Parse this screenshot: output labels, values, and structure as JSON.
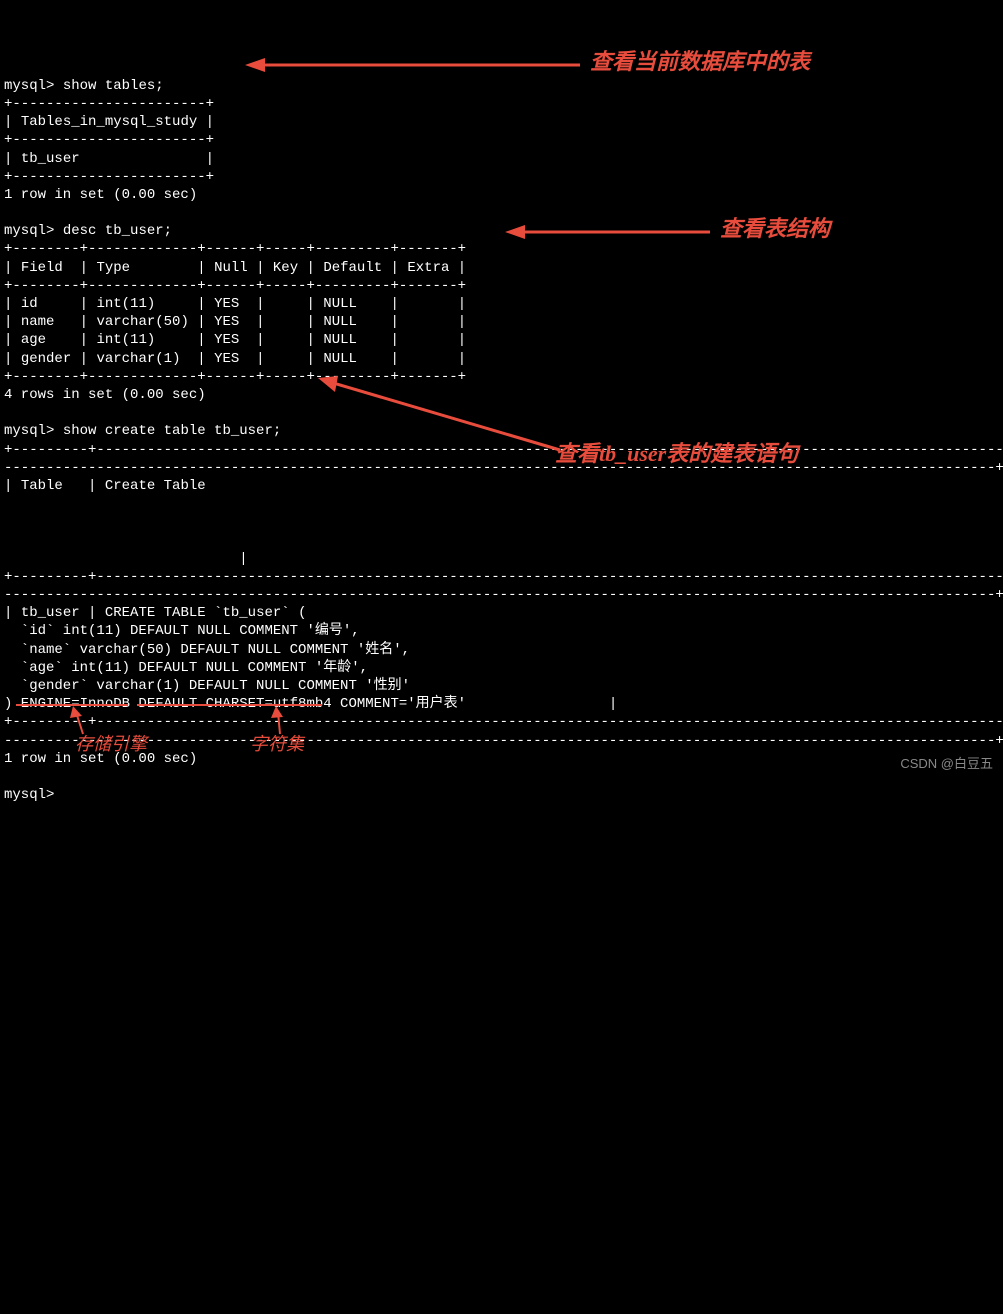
{
  "prompt": "mysql>",
  "cmd1": "show tables;",
  "tables_header": "Tables_in_mysql_study",
  "tables_row1": "tb_user",
  "tables_result": "1 row in set (0.00 sec)",
  "cmd2": "desc tb_user;",
  "desc": {
    "headers": [
      "Field",
      "Type",
      "Null",
      "Key",
      "Default",
      "Extra"
    ],
    "rows": [
      {
        "field": "id",
        "type": "int(11)",
        "null": "YES",
        "key": "",
        "default": "NULL",
        "extra": ""
      },
      {
        "field": "name",
        "type": "varchar(50)",
        "null": "YES",
        "key": "",
        "default": "NULL",
        "extra": ""
      },
      {
        "field": "age",
        "type": "int(11)",
        "null": "YES",
        "key": "",
        "default": "NULL",
        "extra": ""
      },
      {
        "field": "gender",
        "type": "varchar(1)",
        "null": "YES",
        "key": "",
        "default": "NULL",
        "extra": ""
      }
    ]
  },
  "desc_result": "4 rows in set (0.00 sec)",
  "cmd3": "show create table tb_user;",
  "create_header1": "Table",
  "create_header2": "Create Table",
  "create_table_name": "tb_user",
  "create_sql_lines": [
    "CREATE TABLE `tb_user` (",
    "  `id` int(11) DEFAULT NULL COMMENT '编号',",
    "  `name` varchar(50) DEFAULT NULL COMMENT '姓名',",
    "  `age` int(11) DEFAULT NULL COMMENT '年龄',",
    "  `gender` varchar(1) DEFAULT NULL COMMENT '性别'",
    ") ENGINE=InnoDB DEFAULT CHARSET=utf8mb4 COMMENT='用户表'"
  ],
  "create_result": "1 row in set (0.00 sec)",
  "annotations": {
    "a1": "查看当前数据库中的表",
    "a2": "查看表结构",
    "a3": "查看tb_user表的建表语句",
    "engine": "存储引擎",
    "charset": "字符集"
  },
  "watermark": "CSDN @白豆五"
}
